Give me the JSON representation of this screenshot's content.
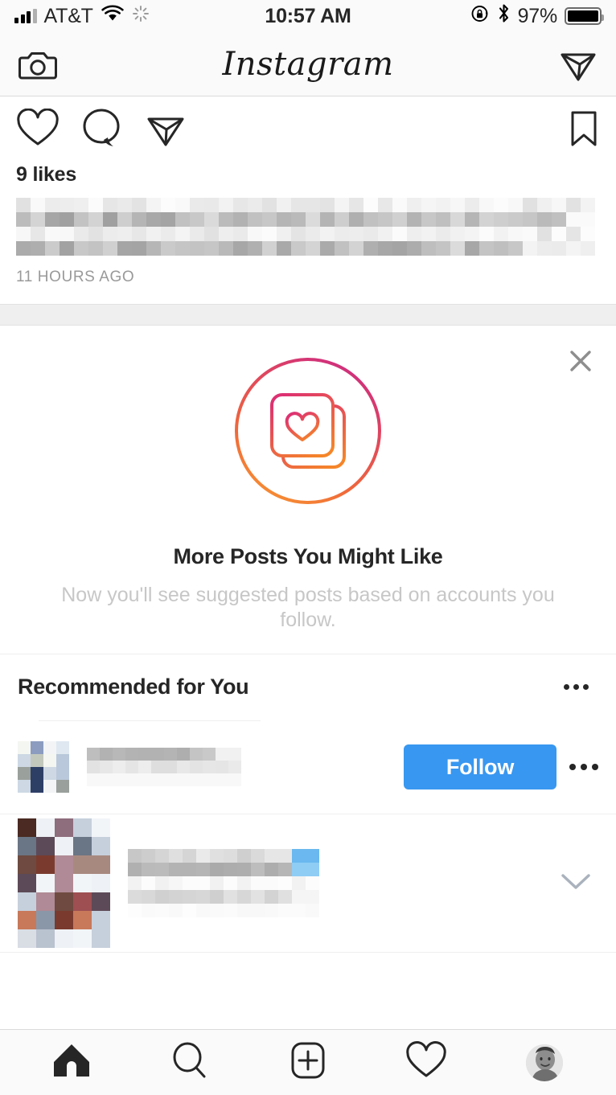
{
  "status_bar": {
    "signal_icon": "cellular-signal-icon",
    "carrier": "AT&T",
    "wifi_icon": "wifi-icon",
    "activity_icon": "activity-spinner-icon",
    "time": "10:57 AM",
    "rotation_lock_icon": "rotation-lock-icon",
    "bluetooth_icon": "bluetooth-icon",
    "battery_percent": "97%",
    "battery_icon": "battery-icon"
  },
  "app_header": {
    "camera_icon": "camera-icon",
    "title": "Instagram",
    "direct_message_icon": "paper-plane-icon"
  },
  "post": {
    "like_icon": "heart-icon",
    "comment_icon": "comment-bubble-icon",
    "share_icon": "paper-plane-icon",
    "save_icon": "bookmark-icon",
    "likes_text": "9 likes",
    "caption_redacted": "[caption pixelated]",
    "timestamp": "11 HOURS AGO"
  },
  "suggestion_card": {
    "close_icon": "close-x-icon",
    "badge_icon": "stacked-photos-heart-icon",
    "title": "More Posts You Might Like",
    "subtitle": "Now you'll see suggested posts based on accounts you follow.",
    "gradient_start": "#d6246e",
    "gradient_end": "#f58529"
  },
  "recommended": {
    "section_title": "Recommended for You",
    "options_icon": "more-options-icon",
    "rows": [
      {
        "avatar": "avatar-redacted",
        "username_redacted": "[username pixelated]",
        "follow_label": "Follow",
        "follow_color": "#3897f0",
        "options_icon": "more-options-icon"
      }
    ],
    "preview_post": {
      "thumbnail": "thumbnail-redacted",
      "text_redacted": "[post text pixelated]",
      "expand_icon": "chevron-down-icon"
    }
  },
  "tab_bar": {
    "tabs": [
      {
        "name": "home-tab",
        "icon": "home-icon",
        "active": true
      },
      {
        "name": "search-tab",
        "icon": "search-icon",
        "active": false
      },
      {
        "name": "create-tab",
        "icon": "plus-square-icon",
        "active": false
      },
      {
        "name": "activity-tab",
        "icon": "heart-icon",
        "active": false
      },
      {
        "name": "profile-tab",
        "icon": "profile-avatar-icon",
        "active": false
      }
    ]
  }
}
